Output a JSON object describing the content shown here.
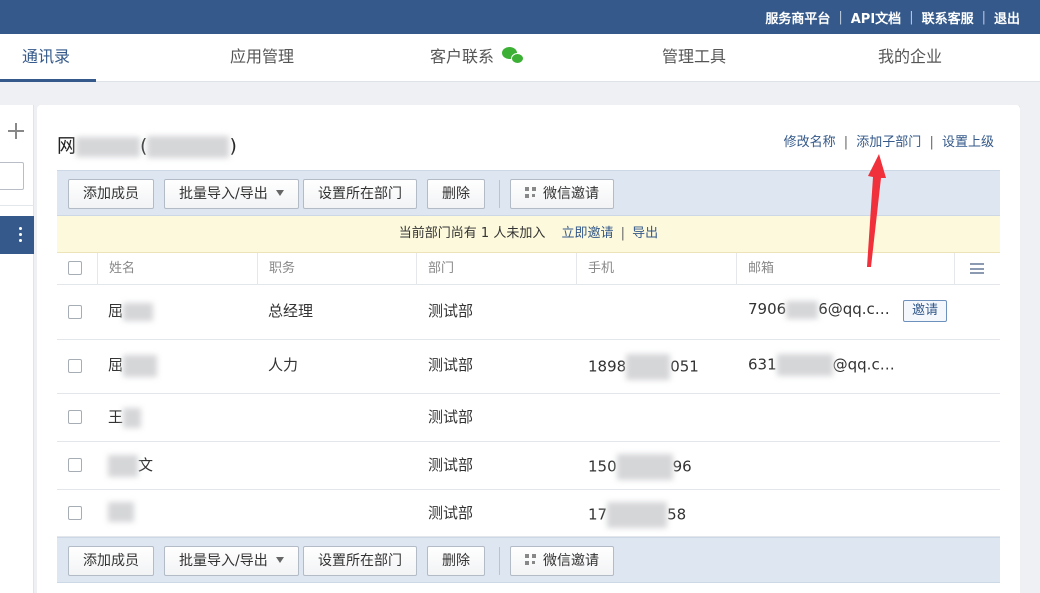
{
  "topbar": {
    "links": [
      "服务商平台",
      "API文档",
      "联系客服",
      "退出"
    ],
    "separator": "|"
  },
  "nav": {
    "tabs": [
      "通讯录",
      "应用管理",
      "客户联系",
      "管理工具",
      "我的企业"
    ],
    "active_tab": "通讯录",
    "tab_icons": {
      "客户联系": "wechat-icon"
    }
  },
  "department": {
    "title_prefix": "网",
    "title_suffix": ")",
    "title_open_paren": "(",
    "actions": [
      "修改名称",
      "添加子部门",
      "设置上级"
    ],
    "separator": "|"
  },
  "toolbar": {
    "add_member": "添加成员",
    "import_export": "批量导入/导出",
    "set_department": "设置所在部门",
    "delete": "删除",
    "wechat_invite": "微信邀请"
  },
  "notice": {
    "text": "当前部门尚有 1 人未加入",
    "invite_now": "立即邀请",
    "separator": "|",
    "export": "导出"
  },
  "table": {
    "columns": [
      "姓名",
      "职务",
      "部门",
      "手机",
      "邮箱"
    ],
    "rows": [
      {
        "name": "屈",
        "title": "总经理",
        "dept": "测试部",
        "phone": "",
        "email_prefix": "7906",
        "email_suffix": "6@qq.c…",
        "action": "邀请"
      },
      {
        "name": "屈",
        "title": "人力",
        "dept": "测试部",
        "phone_prefix": "1898",
        "phone_suffix": "051",
        "email_prefix": "631",
        "email_suffix": "@qq.c…",
        "action": ""
      },
      {
        "name": "王",
        "title": "",
        "dept": "测试部",
        "phone": "",
        "email_prefix": "",
        "email_suffix": "",
        "action": ""
      },
      {
        "name_suffix": "文",
        "title": "",
        "dept": "测试部",
        "phone_prefix": "150",
        "phone_suffix": "96",
        "email_prefix": "",
        "email_suffix": "",
        "action": ""
      },
      {
        "name": "",
        "title": "",
        "dept": "测试部",
        "phone_prefix": "17",
        "phone_suffix": "58",
        "email_prefix": "",
        "email_suffix": "",
        "action": ""
      }
    ]
  },
  "colors": {
    "brand": "#34598a",
    "toolbar_bg": "#dde6f1",
    "notice_bg": "#fdf9dc",
    "arrow": "#f0303a"
  }
}
